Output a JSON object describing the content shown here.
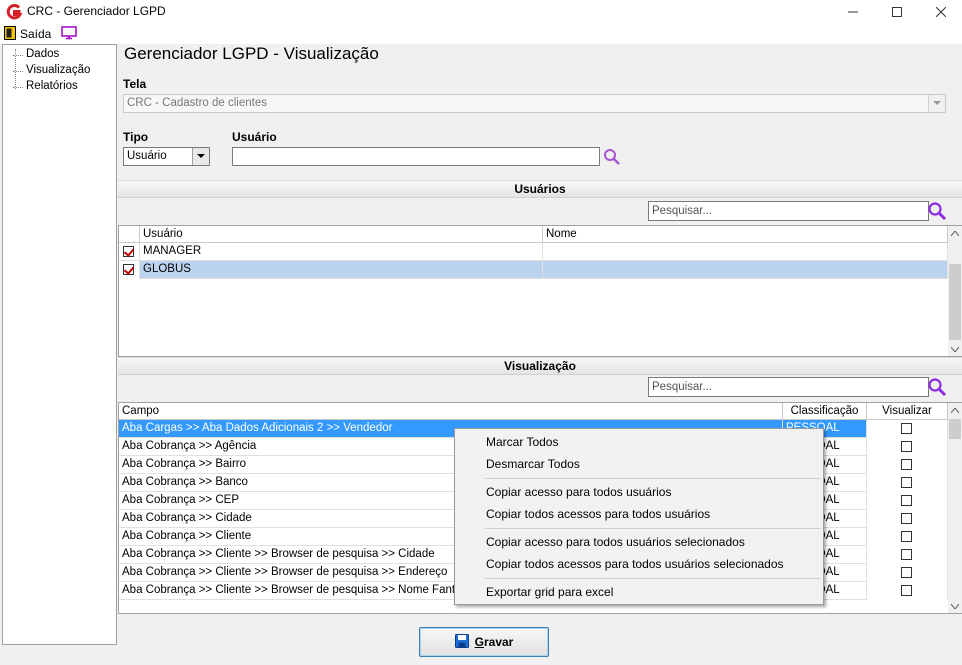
{
  "window": {
    "title": "CRC - Gerenciador LGPD",
    "controls": {
      "minimize": "—",
      "maximize": "☐",
      "close": "✕"
    }
  },
  "menu": {
    "saida": "Saída"
  },
  "sidebar": {
    "items": [
      {
        "label": "Dados"
      },
      {
        "label": "Visualização"
      },
      {
        "label": "Relatórios"
      }
    ]
  },
  "header": {
    "title": "Gerenciador LGPD - Visualização"
  },
  "form": {
    "tela_label": "Tela",
    "tela_value": "CRC - Cadastro de clientes",
    "tipo_label": "Tipo",
    "tipo_value": "Usuário",
    "usuario_label": "Usuário",
    "usuario_value": ""
  },
  "usuarios_section": {
    "title": "Usuários",
    "search_placeholder": "Pesquisar...",
    "columns": [
      "Usuário",
      "Nome"
    ],
    "rows": [
      {
        "usuario": "MANAGER",
        "nome": "",
        "checked": true,
        "selected": false
      },
      {
        "usuario": "GLOBUS",
        "nome": "",
        "checked": true,
        "selected": true
      }
    ]
  },
  "visualizacao_section": {
    "title": "Visualização",
    "search_placeholder": "Pesquisar...",
    "columns": [
      "Campo",
      "Classificação",
      "Visualizar"
    ],
    "rows": [
      {
        "campo": "Aba Cargas >> Aba Dados Adicionais 2 >> Vendedor",
        "classificacao": "PESSOAL",
        "visualizar": false,
        "selected": true
      },
      {
        "campo": "Aba Cobrança >> Agência",
        "classificacao": "PESSOAL",
        "visualizar": false
      },
      {
        "campo": "Aba Cobrança >> Bairro",
        "classificacao": "PESSOAL",
        "visualizar": false
      },
      {
        "campo": "Aba Cobrança >> Banco",
        "classificacao": "PESSOAL",
        "visualizar": false
      },
      {
        "campo": "Aba Cobrança >> CEP",
        "classificacao": "PESSOAL",
        "visualizar": false
      },
      {
        "campo": "Aba Cobrança >> Cidade",
        "classificacao": "PESSOAL",
        "visualizar": false
      },
      {
        "campo": "Aba Cobrança >> Cliente",
        "classificacao": "PESSOAL",
        "visualizar": false
      },
      {
        "campo": "Aba Cobrança >> Cliente >> Browser de pesquisa >> Cidade",
        "classificacao": "PESSOAL",
        "visualizar": false
      },
      {
        "campo": "Aba Cobrança >> Cliente >> Browser de pesquisa >> Endereço",
        "classificacao": "PESSOAL",
        "visualizar": false
      },
      {
        "campo": "Aba Cobrança >> Cliente >> Browser de pesquisa >> Nome Fantasia",
        "classificacao": "PESSOAL",
        "visualizar": false
      }
    ]
  },
  "context_menu": {
    "items": [
      "Marcar Todos",
      "Desmarcar Todos",
      "Copiar acesso para todos usuários",
      "Copiar todos acessos para todos usuários",
      "Copiar acesso para todos usuários selecionados",
      "Copiar todos acessos para todos usuários selecionados",
      "Exportar grid para excel"
    ]
  },
  "footer": {
    "gravar_prefix": "G",
    "gravar_rest": "ravar"
  },
  "colors": {
    "selection": "#3399ff",
    "row_selected": "#bcd3f0",
    "search_icon": "#8a2be2",
    "logo_red": "#d61f26"
  }
}
